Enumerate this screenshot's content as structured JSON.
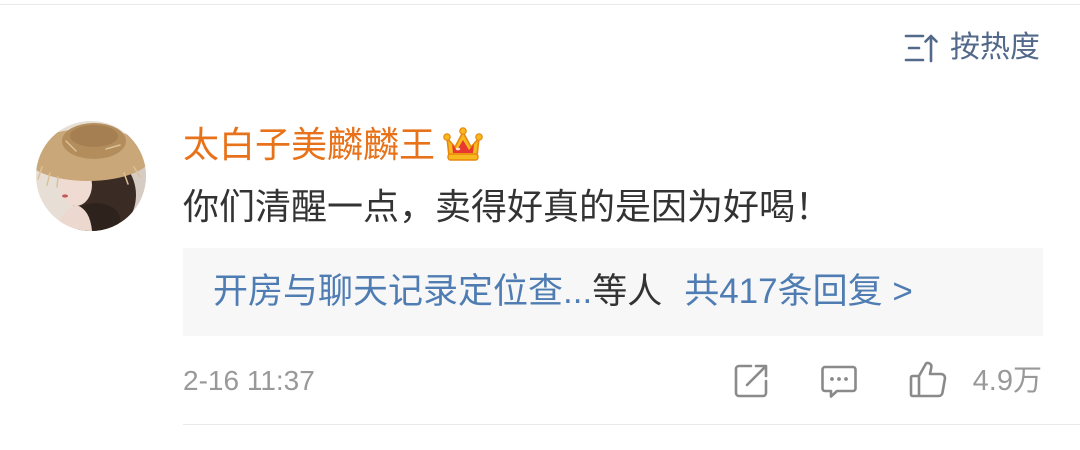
{
  "sort": {
    "icon": "sort-icon",
    "label": "按热度"
  },
  "comment": {
    "avatar_icon": "avatar-photo",
    "username": "太白子美麟麟王",
    "badge_icon": "crown-icon",
    "text": "你们清醒一点，卖得好真的是因为好喝！",
    "replies": {
      "users": "开房与聊天记录定位查...",
      "users_suffix": "等人",
      "count": "共417条回复 >"
    },
    "timestamp": "2-16 11:37",
    "actions": {
      "share_icon": "share-icon",
      "comment_icon": "comment-icon",
      "like_icon": "like-icon",
      "like_count": "4.9万"
    }
  },
  "colors": {
    "username": "#e8721a",
    "link": "#4f7db3",
    "sort": "#52698a",
    "meta": "#999999",
    "text": "#333333",
    "reply_bg": "#f7f7f7",
    "icon": "#8a8a8a",
    "divider": "#e9e9e9"
  }
}
